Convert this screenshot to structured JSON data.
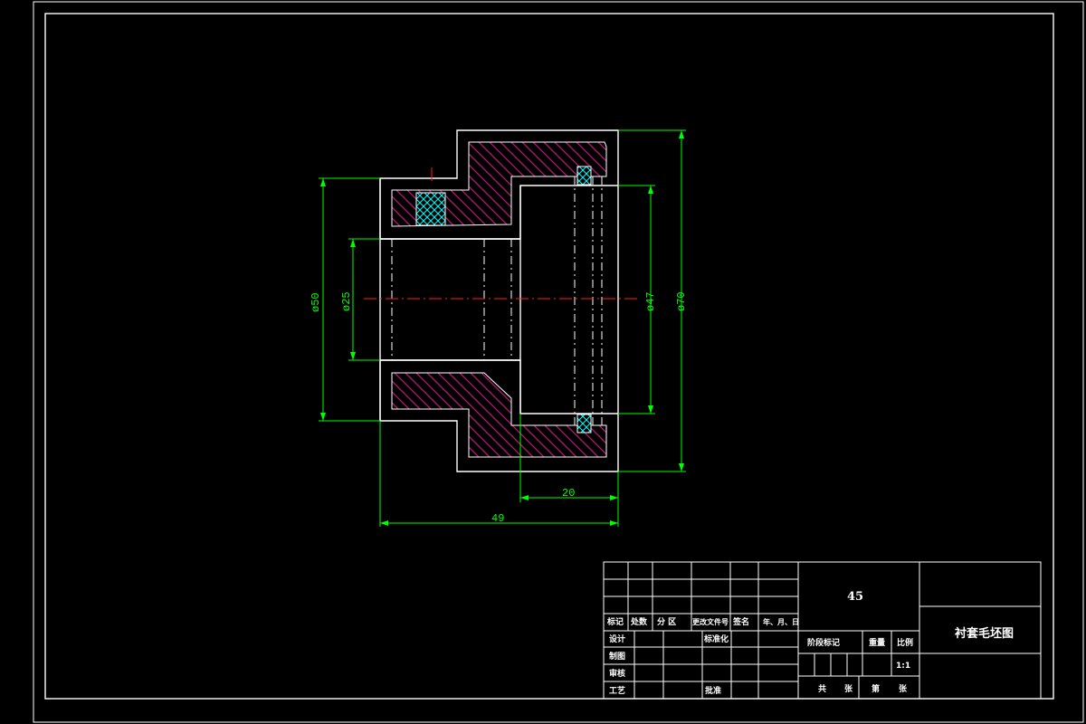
{
  "drawing": {
    "title": "衬套毛坯图",
    "material": "45",
    "scale": "1:1",
    "colors": {
      "background": "#000000",
      "border": "#ffffff",
      "dimension": "#00ff00",
      "centerline": "#ff2020",
      "part_section": "#c0147c",
      "allowance_hatch": "#00ffff"
    }
  },
  "dimensions": {
    "d50": "ø50",
    "d25": "ø25",
    "d47": "ø47",
    "d70": "ø70",
    "len20": "20",
    "len49": "49"
  },
  "title_block": {
    "row_headers": [
      "标记",
      "处数",
      "分  区",
      "更改文件号",
      "签名",
      "年、月、日"
    ],
    "design": "设计",
    "standardize": "标准化",
    "draw": "制图",
    "review": "审核",
    "process": "工艺",
    "approve": "批准",
    "stage_mark": "阶段标记",
    "weight": "重量",
    "scale_label": "比例",
    "total": "共",
    "sheets": "张",
    "sheet_no": "第",
    "sheet_unit": "张"
  }
}
